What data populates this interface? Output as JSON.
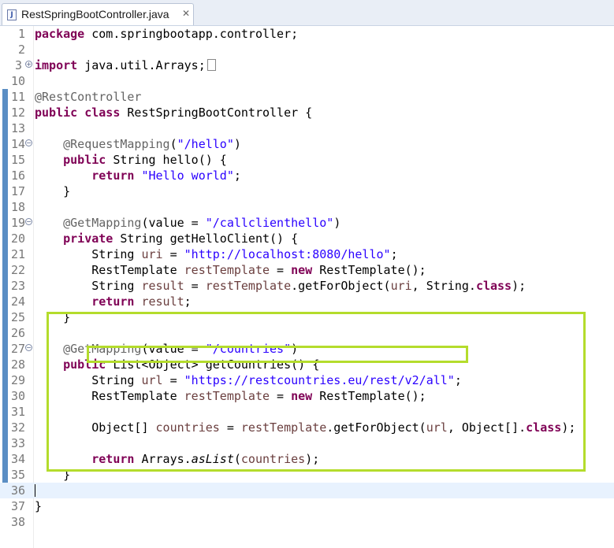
{
  "tab": {
    "icon": "java-file-icon",
    "icon_glyph": "J",
    "title": "RestSpringBootController.java",
    "close_glyph": "✕"
  },
  "code": {
    "l1": {
      "num": "1",
      "parts": [
        "package",
        " com.springbootapp.controller;"
      ]
    },
    "l2": {
      "num": "2"
    },
    "l3": {
      "num": "3",
      "parts": [
        "import",
        " java.util.Arrays;"
      ]
    },
    "l10": {
      "num": "10"
    },
    "l11": {
      "num": "11",
      "parts": [
        "@RestController"
      ]
    },
    "l12": {
      "num": "12",
      "parts": [
        "public",
        " ",
        "class",
        " RestSpringBootController {"
      ]
    },
    "l13": {
      "num": "13"
    },
    "l14": {
      "num": "14",
      "parts": [
        "    ",
        "@RequestMapping",
        "(",
        "\"/hello\"",
        ")"
      ]
    },
    "l15": {
      "num": "15",
      "parts": [
        "    ",
        "public",
        " String hello() {"
      ]
    },
    "l16": {
      "num": "16",
      "parts": [
        "        ",
        "return",
        " ",
        "\"Hello world\"",
        ";"
      ]
    },
    "l17": {
      "num": "17",
      "parts": [
        "    }"
      ]
    },
    "l18": {
      "num": "18"
    },
    "l19": {
      "num": "19",
      "parts": [
        "    ",
        "@GetMapping",
        "(value = ",
        "\"/callclienthello\"",
        ")"
      ]
    },
    "l20": {
      "num": "20",
      "parts": [
        "    ",
        "private",
        " String getHelloClient() {"
      ]
    },
    "l21": {
      "num": "21",
      "parts": [
        "        String ",
        "uri",
        " = ",
        "\"http://localhost:8080/hello\"",
        ";"
      ]
    },
    "l22": {
      "num": "22",
      "parts": [
        "        RestTemplate ",
        "restTemplate",
        " = ",
        "new",
        " RestTemplate();"
      ]
    },
    "l23": {
      "num": "23",
      "parts": [
        "        String ",
        "result",
        " = ",
        "restTemplate",
        ".getForObject(",
        "uri",
        ", String.",
        "class",
        ");"
      ]
    },
    "l24": {
      "num": "24",
      "parts": [
        "        ",
        "return",
        " ",
        "result",
        ";"
      ]
    },
    "l25": {
      "num": "25",
      "parts": [
        "    }"
      ]
    },
    "l26": {
      "num": "26"
    },
    "l27": {
      "num": "27",
      "parts": [
        "    ",
        "@GetMapping",
        "(value = ",
        "\"/countries\"",
        ")"
      ]
    },
    "l28": {
      "num": "28",
      "parts": [
        "    ",
        "public",
        " List<Object> getCountries() {"
      ]
    },
    "l29": {
      "num": "29",
      "parts": [
        "        String ",
        "url",
        " = ",
        "\"https://restcountries.eu/rest/v2/all\"",
        ";"
      ]
    },
    "l30": {
      "num": "30",
      "parts": [
        "        RestTemplate ",
        "restTemplate",
        " = ",
        "new",
        " RestTemplate();"
      ]
    },
    "l31": {
      "num": "31"
    },
    "l32": {
      "num": "32",
      "parts": [
        "        Object[] ",
        "countries",
        " = ",
        "restTemplate",
        ".getForObject(",
        "url",
        ", Object[].",
        "class",
        ");"
      ]
    },
    "l33": {
      "num": "33"
    },
    "l34": {
      "num": "34",
      "parts": [
        "        ",
        "return",
        " Arrays.",
        "asList",
        "(",
        "countries",
        ");"
      ]
    },
    "l35": {
      "num": "35",
      "parts": [
        "    }"
      ]
    },
    "l36": {
      "num": "36"
    },
    "l37": {
      "num": "37",
      "parts": [
        "}"
      ]
    },
    "l38": {
      "num": "38"
    }
  },
  "fold_glyphs": {
    "expand": "+",
    "collapse": "−"
  },
  "colors": {
    "keyword": "#7f0055",
    "string": "#2a00ff",
    "annotation": "#646464",
    "field": "#6a3e3e",
    "highlight_box": "#b4dc2c",
    "current_line": "#e8f2fe"
  }
}
